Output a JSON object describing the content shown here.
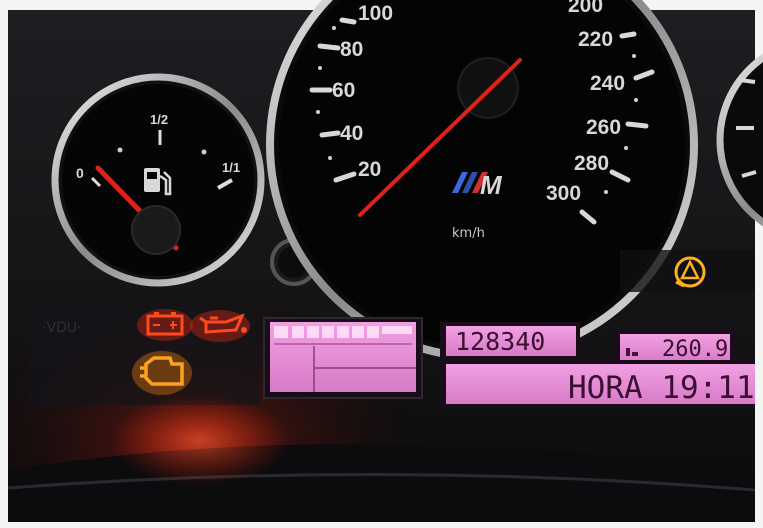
{
  "fuel_gauge": {
    "label_empty": "0",
    "label_half": "1/2",
    "label_full": "1/1",
    "needle_level": 0.0,
    "icon": "fuel-pump-icon"
  },
  "speedometer": {
    "unit": "km/h",
    "brand_mark": "M",
    "visible_scale": [
      "20",
      "40",
      "60",
      "80",
      "100",
      "200",
      "220",
      "240",
      "260",
      "280",
      "300"
    ],
    "needle_value_kmh": 220
  },
  "warning_lights": {
    "battery": {
      "icon": "battery-icon",
      "color": "#ff2a10",
      "on": true
    },
    "oil": {
      "icon": "oil-can-icon",
      "color": "#ff2a10",
      "on": true
    },
    "check_engine": {
      "icon": "engine-icon",
      "color": "#ffa020",
      "on": true
    },
    "service": {
      "icon": "service-triangle-icon",
      "color": "#ffb020",
      "on": true
    }
  },
  "displays": {
    "odometer": "128340",
    "trip": "260.9",
    "message": "HORA 19:11",
    "lcd_color": "#e88ad8"
  },
  "colors": {
    "needle": "#e0201a",
    "bezel": "#c8c8c8",
    "dial_face": "#050505"
  }
}
